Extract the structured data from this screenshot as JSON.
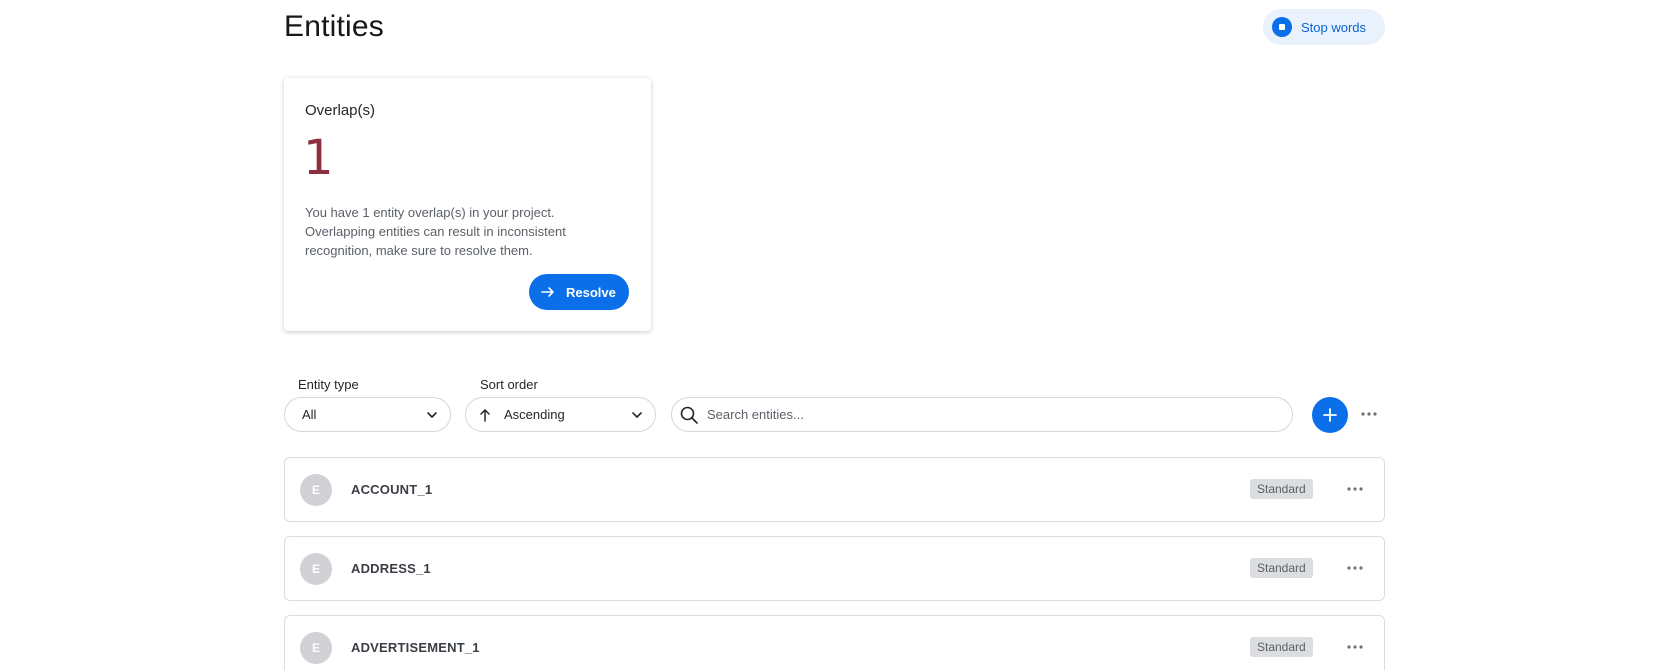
{
  "header": {
    "title": "Entities",
    "stop_words_label": "Stop words"
  },
  "overlap_card": {
    "title": "Overlap(s)",
    "count": "1",
    "description": "You have 1 entity overlap(s) in your project. Overlapping entities can result in inconsistent recognition, make sure to resolve them.",
    "resolve_label": "Resolve"
  },
  "filters": {
    "entity_type_label": "Entity type",
    "entity_type_value": "All",
    "sort_order_label": "Sort order",
    "sort_order_value": "Ascending",
    "search_placeholder": "Search entities..."
  },
  "entities": [
    {
      "initial": "E",
      "name": "ACCOUNT_1",
      "badge": "Standard"
    },
    {
      "initial": "E",
      "name": "ADDRESS_1",
      "badge": "Standard"
    },
    {
      "initial": "E",
      "name": "ADVERTISEMENT_1",
      "badge": "Standard"
    }
  ],
  "colors": {
    "accent": "#0a6fe8",
    "overlap_count": "#8e2f3f",
    "badge_bg": "#dcdde0"
  }
}
